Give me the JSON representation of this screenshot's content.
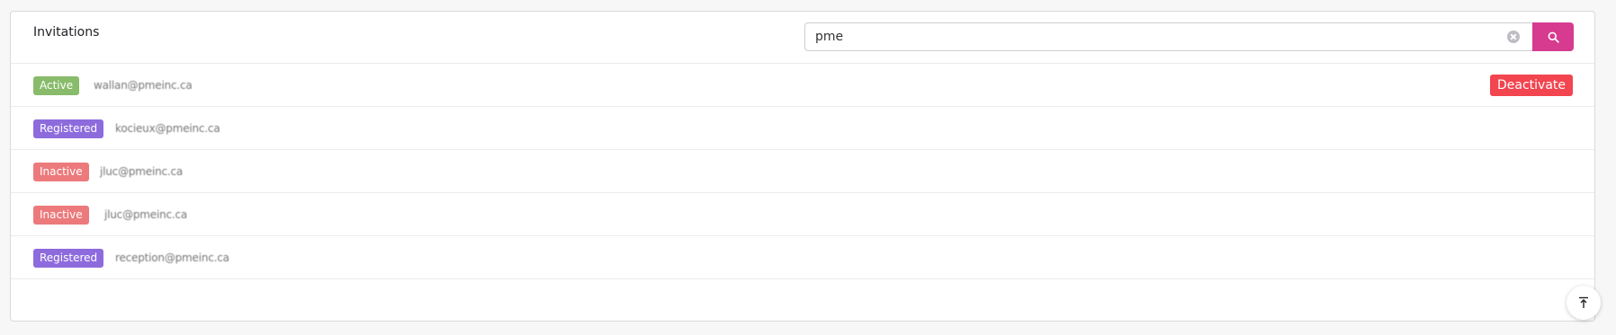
{
  "header": {
    "title": "Invitations"
  },
  "search": {
    "value": "pme",
    "clear_icon": "clear-circle-icon",
    "button_icon": "search-icon",
    "button_color": "#d63b8f"
  },
  "invitations": [
    {
      "status": "Active",
      "status_color": "#88bb6a",
      "email": "wallan@pmeinc.ca",
      "action_label": "Deactivate",
      "action_color": "#f2454f"
    },
    {
      "status": "Registered",
      "status_color": "#8d6bdd",
      "email": "kocieux@pmeinc.ca"
    },
    {
      "status": "Inactive",
      "status_color": "#ec7a7c",
      "email": "jluc@pmeinc.ca"
    },
    {
      "status": "Inactive",
      "status_color": "#ec7a7c",
      "email": "jluc@pmeinc.ca"
    },
    {
      "status": "Registered",
      "status_color": "#8d6bdd",
      "email": "reception@pmeinc.ca"
    }
  ],
  "scroll_top": {
    "icon": "arrow-up-to-line-icon"
  }
}
